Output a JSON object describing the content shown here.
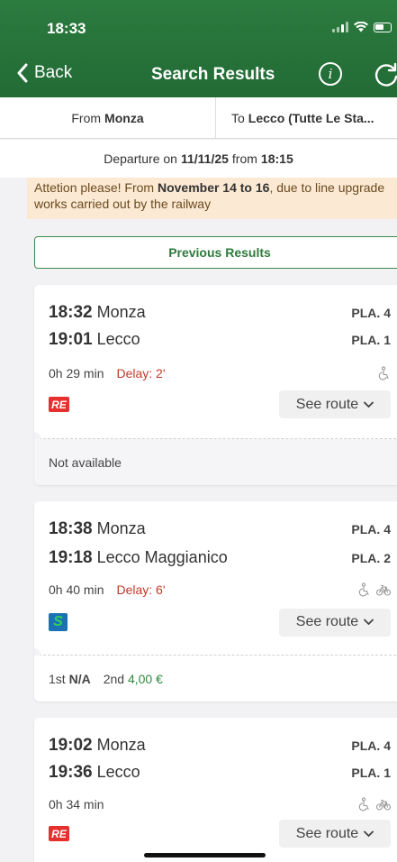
{
  "status": {
    "time": "18:33"
  },
  "nav": {
    "back_label": "Back",
    "title": "Search Results",
    "info_glyph": "i"
  },
  "route": {
    "from_prefix": "From",
    "from_station": "Monza",
    "to_prefix": "To",
    "to_station": "Lecco (Tutte Le Sta..."
  },
  "departure": {
    "prefix": "Departure on",
    "date": "11/11/25",
    "from_word": "from",
    "time": "18:15"
  },
  "alert": {
    "part1": "Attetion please! From ",
    "bold": "November 14 to 16",
    "part2": ", due to line upgrade works carried out by the railway"
  },
  "prev_results_label": "Previous Results",
  "see_route_label": "See route",
  "solutions": [
    {
      "dep_time": "18:32",
      "dep_station": "Monza",
      "dep_platform": "PLA. 4",
      "arr_time": "19:01",
      "arr_station": "Lecco",
      "arr_platform": "PLA. 1",
      "duration": "0h 29 min",
      "delay": "Delay: 2'",
      "train_badge": "RE",
      "footer": "Not available"
    },
    {
      "dep_time": "18:38",
      "dep_station": "Monza",
      "dep_platform": "PLA. 4",
      "arr_time": "19:18",
      "arr_station": "Lecco Maggianico",
      "arr_platform": "PLA. 2",
      "duration": "0h 40 min",
      "delay": "Delay: 6'",
      "train_badge": "S",
      "price": {
        "first_label": "1st",
        "first_value": "N/A",
        "second_label": "2nd",
        "second_value": "4,00 €"
      }
    },
    {
      "dep_time": "19:02",
      "dep_station": "Monza",
      "dep_platform": "PLA. 4",
      "arr_time": "19:36",
      "arr_station": "Lecco",
      "arr_platform": "PLA. 1",
      "duration": "0h 34 min",
      "train_badge": "RE"
    }
  ],
  "colors": {
    "header_green": "#2c7b3f",
    "delay_red": "#c0392b",
    "price_green": "#2f8a3e",
    "alert_bg": "#fbe9d3"
  },
  "icons": [
    "back-chevron-icon",
    "info-icon",
    "refresh-icon",
    "wheelchair-icon",
    "bicycle-icon",
    "chevron-down-icon",
    "signal-icon",
    "wifi-icon",
    "battery-icon"
  ]
}
